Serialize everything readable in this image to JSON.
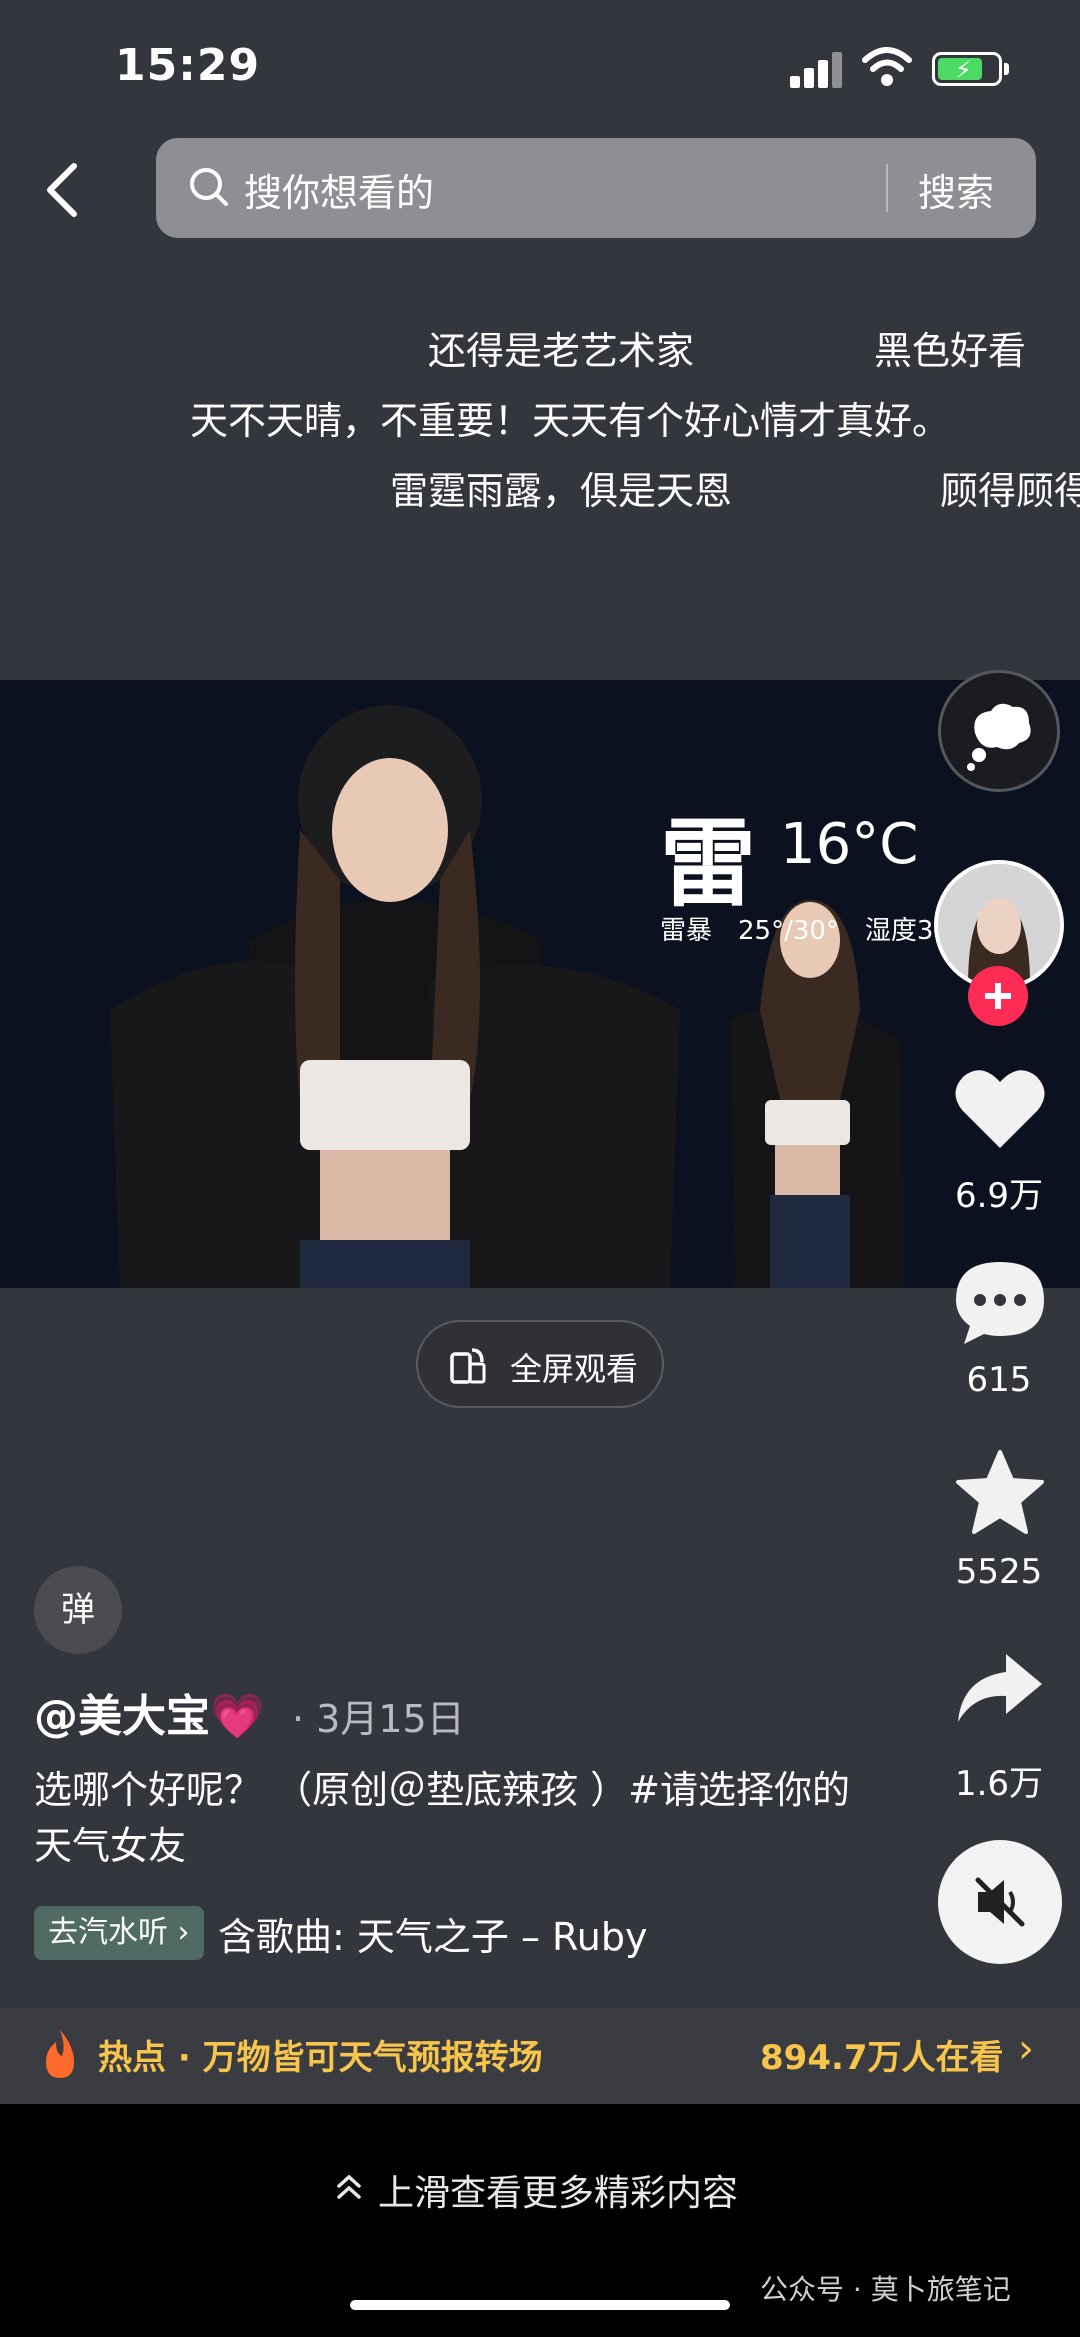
{
  "status_bar": {
    "time": "15:29"
  },
  "search": {
    "placeholder": "搜你想看的",
    "button": "搜索"
  },
  "danmaku": [
    "还得是老艺术家",
    "黑色好看",
    "天不天晴，不重要！天天有个好心情才真好。",
    "雷霆雨露，俱是天恩",
    "顾得顾得"
  ],
  "video": {
    "weather_char": "雷",
    "temperature": "16°C",
    "weather_detail": "雷暴　25°/30°　湿度3",
    "fullscreen_label": "全屏观看"
  },
  "rail": {
    "likes": "6.9万",
    "comments": "615",
    "favorites": "5525",
    "shares": "1.6万"
  },
  "caption": {
    "danmu_button": "弹",
    "author": "@美大宝💗",
    "date": "· 3月15日",
    "text": "选哪个好呢？ （原创＠垫底辣孩 ）#请选择你的天气女友",
    "music_chip": "去汽水听 ›",
    "music": "含歌曲: 天气之子 – Ruby"
  },
  "hot": {
    "text": "热点 · 万物皆可天气预报转场",
    "count": "894.7万人在看"
  },
  "bottom": {
    "swipe_hint": "上滑查看更多精彩内容",
    "watermark": "公众号 · 莫卜旅笔记"
  },
  "colors": {
    "accent_red": "#fe2c55",
    "hot_yellow": "#f7c54b",
    "background": "#34363d"
  }
}
